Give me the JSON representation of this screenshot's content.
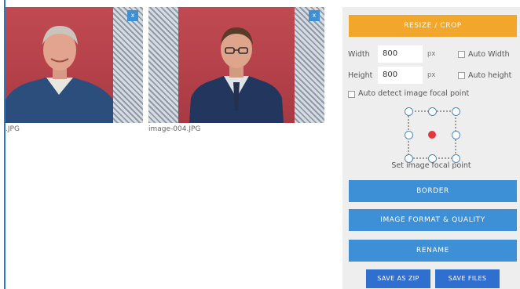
{
  "images": [
    {
      "filename": ".JPG",
      "remove_label": "x"
    },
    {
      "filename": "image-004.JPG",
      "remove_label": "x"
    }
  ],
  "panel": {
    "resize_crop_label": "RESIZE / CROP",
    "width_label": "Width",
    "width_value": "800",
    "width_unit": "px",
    "auto_width_label": "Auto Width",
    "height_label": "Height",
    "height_value": "800",
    "height_unit": "px",
    "auto_height_label": "Auto height",
    "auto_detect_label": "Auto detect image focal point",
    "focal_point_label": "Set image focal point",
    "border_label": "BORDER",
    "format_quality_label": "IMAGE FORMAT & QUALITY",
    "rename_label": "RENAME",
    "save_zip_label": "SAVE AS ZIP",
    "save_files_label": "SAVE FILES"
  },
  "colors": {
    "accent_orange": "#f3a72a",
    "accent_blue": "#3d8fd6",
    "save_blue": "#2f6fd0",
    "focal_center": "#e23a3a"
  }
}
